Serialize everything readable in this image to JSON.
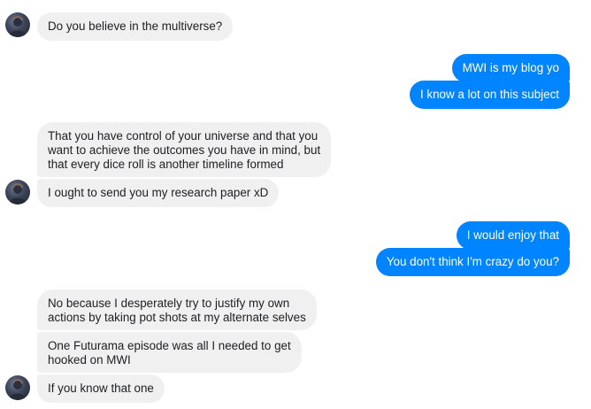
{
  "conversation": {
    "messages": [
      {
        "sender": "other",
        "text": "Do you believe in the multiverse?"
      },
      {
        "sender": "me",
        "text": "MWI is my blog yo"
      },
      {
        "sender": "me",
        "text": "I know a lot on this subject"
      },
      {
        "sender": "other",
        "text": "That you have control of your universe and that you\nwant to achieve the outcomes you have in mind, but\nthat every dice roll is another timeline formed"
      },
      {
        "sender": "other",
        "text": "I ought to send you my research paper xD"
      },
      {
        "sender": "me",
        "text": "I would enjoy that"
      },
      {
        "sender": "me",
        "text": "You don't think I'm crazy do you?"
      },
      {
        "sender": "other",
        "text": "No because I desperately try to justify my own\nactions by taking pot shots at my alternate selves"
      },
      {
        "sender": "other",
        "text": "One Futurama episode was all I needed to get\nhooked on MWI"
      },
      {
        "sender": "other",
        "text": "If you know that one"
      }
    ]
  },
  "colors": {
    "outgoing_bubble": "#0084ff",
    "incoming_bubble": "#f1f0f0",
    "incoming_text": "#1c1e21",
    "outgoing_text": "#ffffff"
  },
  "icons": {
    "avatar": "contact-avatar-icon"
  }
}
